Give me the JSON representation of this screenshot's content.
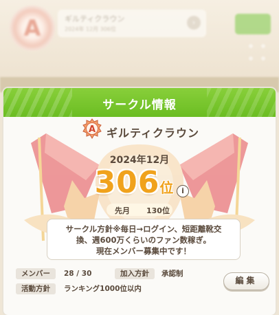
{
  "background": {
    "circle_title": "ギルティクラウン",
    "circle_sub": "2024年 12月 306位",
    "emblem_letter": "A"
  },
  "dialog": {
    "title": "サークル情報",
    "circle": {
      "emblem_letter": "A",
      "name": "ギルティクラウン"
    },
    "month": "2024年12月",
    "rank": {
      "number": "306",
      "unit": "位"
    },
    "info_icon": "i",
    "previous": {
      "label": "先月",
      "value": "130位"
    },
    "policy": {
      "line1": "サークル方針※毎日→ログイン、短距離靴交",
      "line2": "換、週600万くらいのファン数稼ぎ。",
      "line3": "現在メンバー募集中です！"
    },
    "fields": {
      "members_label": "メンバー",
      "members_value": "28 / 30",
      "join_label": "加入方針",
      "join_value": "承認制",
      "activity_label": "活動方針",
      "activity_value": "ランキング1000位以内"
    },
    "edit_button": "編集"
  },
  "colors": {
    "header_green": "#7cc52e",
    "rank_orange": "#f0a21c",
    "text_brown": "#5a4a3c",
    "flag_red": "#e2484d"
  }
}
